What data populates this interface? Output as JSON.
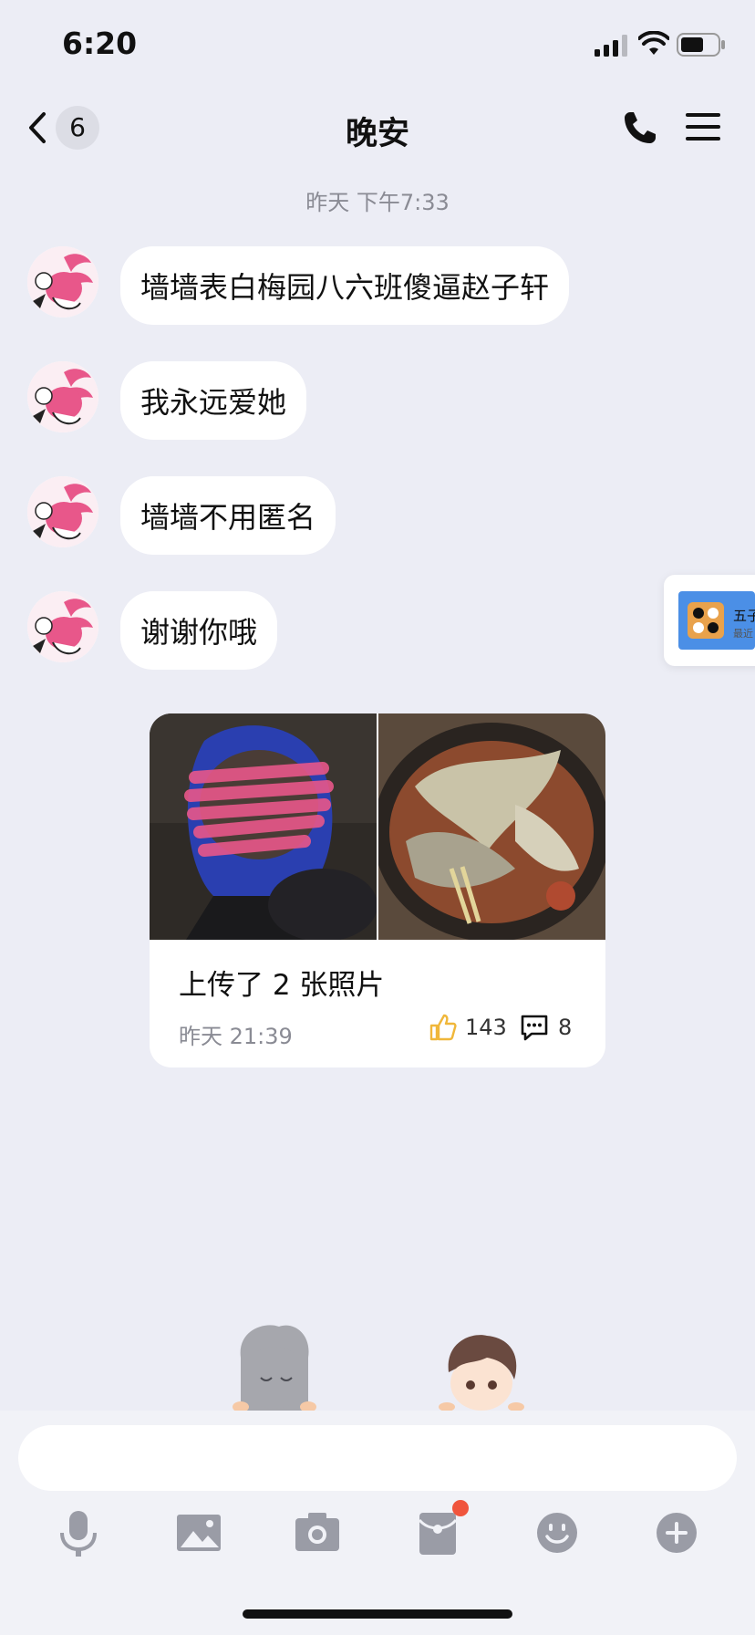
{
  "status_bar": {
    "time": "6:20"
  },
  "nav": {
    "unread_count": "6",
    "title": "晚安"
  },
  "chat": {
    "timestamp": "昨天 下午7:33",
    "messages": [
      {
        "text": "墙墙表白梅园八六班傻逼赵子轩"
      },
      {
        "text": "我永远爱她"
      },
      {
        "text": "墙墙不用匿名"
      },
      {
        "text": "谢谢你哦"
      }
    ]
  },
  "post": {
    "text": "上传了 2 张照片",
    "time": "昨天 21:39",
    "likes": "143",
    "comments": "8"
  },
  "floating_game": {
    "title": "五子",
    "subtitle": "最近"
  },
  "input": {
    "placeholder": ""
  },
  "colors": {
    "background": "#ecedf5",
    "bubble": "#ffffff",
    "icon_gray": "#9a9ca6",
    "like_yellow": "#f0b73a",
    "badge_red": "#f0553d",
    "avatar_pink": "#e8578a"
  }
}
